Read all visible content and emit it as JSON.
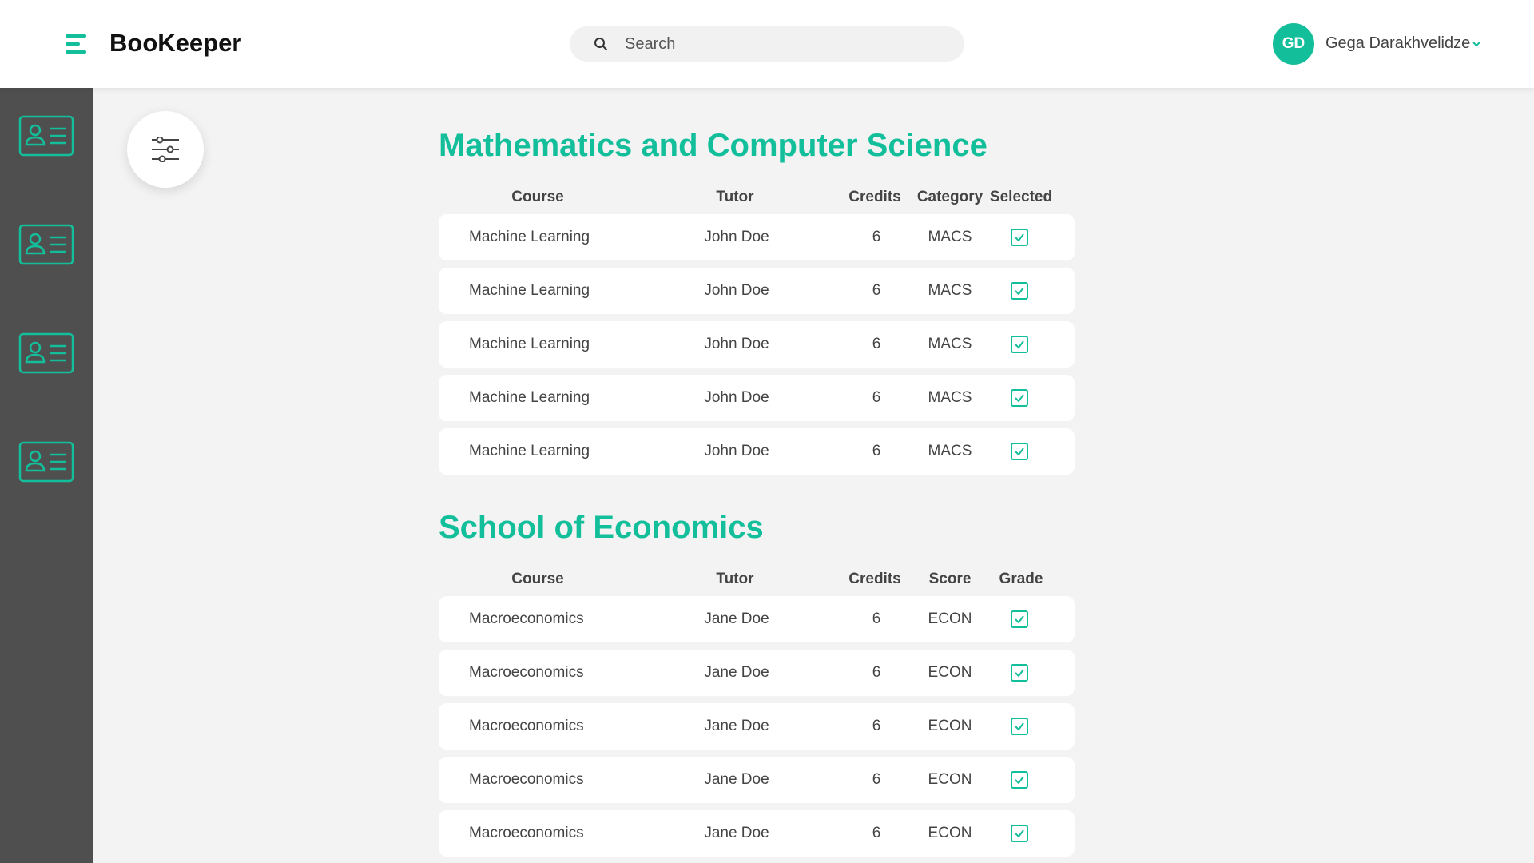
{
  "app": {
    "title": "BooKeeper"
  },
  "search": {
    "placeholder": "Search"
  },
  "user": {
    "initials": "GD",
    "name": "Gega Darakhvelidze"
  },
  "colors": {
    "accent": "#13bf9b",
    "sidebar": "#4f4f4f",
    "background": "#f3f3f3"
  },
  "sidebar": {
    "items": [
      {
        "icon": "contact-card-icon"
      },
      {
        "icon": "contact-card-icon"
      },
      {
        "icon": "contact-card-icon"
      },
      {
        "icon": "contact-card-icon"
      }
    ]
  },
  "sections": [
    {
      "title": "Mathematics and Computer Science",
      "columns": [
        "Course",
        "Tutor",
        "Credits",
        "Category",
        "Selected"
      ],
      "rows": [
        {
          "course": "Machine Learning",
          "tutor": "John Doe",
          "credits": "6",
          "category": "MACS",
          "checked": true
        },
        {
          "course": "Machine Learning",
          "tutor": "John Doe",
          "credits": "6",
          "category": "MACS",
          "checked": true
        },
        {
          "course": "Machine Learning",
          "tutor": "John Doe",
          "credits": "6",
          "category": "MACS",
          "checked": true
        },
        {
          "course": "Machine Learning",
          "tutor": "John Doe",
          "credits": "6",
          "category": "MACS",
          "checked": true
        },
        {
          "course": "Machine Learning",
          "tutor": "John Doe",
          "credits": "6",
          "category": "MACS",
          "checked": true
        }
      ]
    },
    {
      "title": "School of Economics",
      "columns": [
        "Course",
        "Tutor",
        "Credits",
        "Score",
        "Grade"
      ],
      "rows": [
        {
          "course": "Macroeconomics",
          "tutor": "Jane Doe",
          "credits": "6",
          "category": "ECON",
          "checked": true
        },
        {
          "course": "Macroeconomics",
          "tutor": "Jane Doe",
          "credits": "6",
          "category": "ECON",
          "checked": true
        },
        {
          "course": "Macroeconomics",
          "tutor": "Jane Doe",
          "credits": "6",
          "category": "ECON",
          "checked": true
        },
        {
          "course": "Macroeconomics",
          "tutor": "Jane Doe",
          "credits": "6",
          "category": "ECON",
          "checked": true
        },
        {
          "course": "Macroeconomics",
          "tutor": "Jane Doe",
          "credits": "6",
          "category": "ECON",
          "checked": true
        }
      ]
    }
  ]
}
